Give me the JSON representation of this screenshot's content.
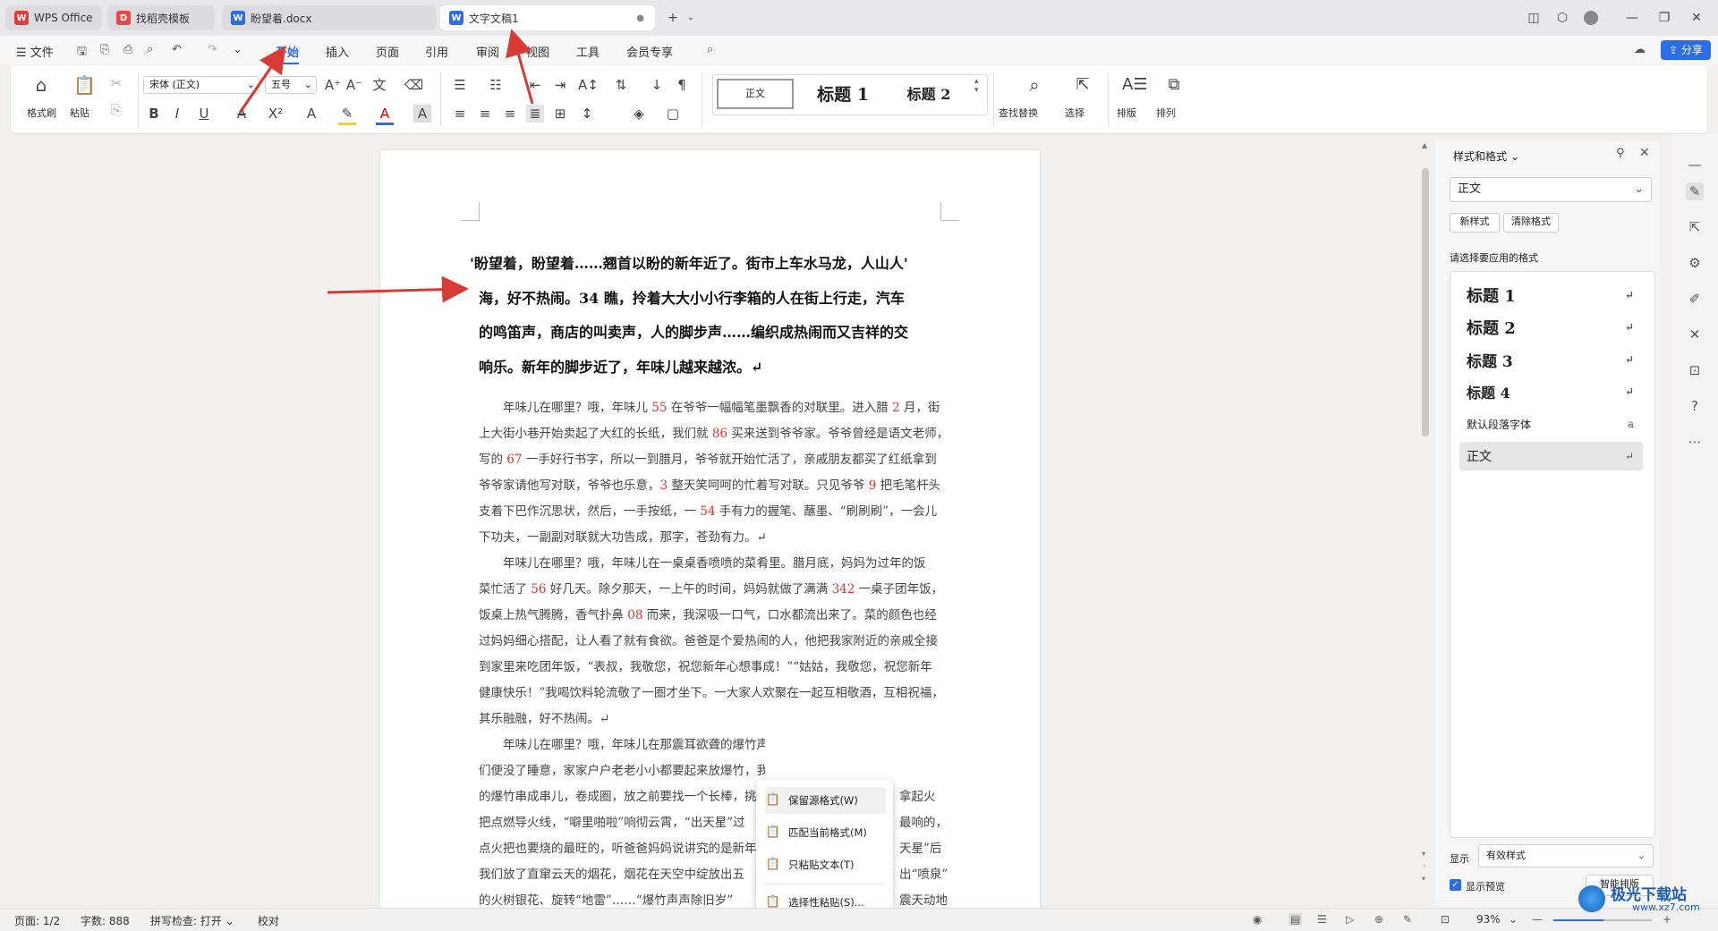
{
  "tabs": [
    {
      "label": "WPS Office",
      "icon": "wps-logo-icon",
      "state": "inactive"
    },
    {
      "label": "找稻壳模板",
      "icon": "docer-icon",
      "state": "inactive"
    },
    {
      "label": "盼望着.docx",
      "icon": "word-doc-icon",
      "state": "inactive"
    },
    {
      "label": "文字文稿1",
      "icon": "word-doc-icon",
      "state": "active"
    }
  ],
  "menu": {
    "file": "文件",
    "items": [
      "开始",
      "插入",
      "页面",
      "引用",
      "审阅",
      "视图",
      "工具",
      "会员专享"
    ],
    "active": "开始",
    "share": "分享"
  },
  "ribbon": {
    "format_painter": "格式刷",
    "paste": "粘贴",
    "font_name": "宋体 (正文)",
    "font_size": "五号",
    "styles": [
      "正文",
      "标题 1",
      "标题 2"
    ],
    "find_replace": "查找替换",
    "select": "选择",
    "layout": "排版",
    "arrange": "排列"
  },
  "document": {
    "bold_lines": [
      "'盼望着，盼望着……翘首以盼的新年近了。街市上车水马龙，人山人'",
      "海，好不热闹。34 瞧，拎着大大小小行李箱的人在街上行走，汽车",
      "的鸣笛声，商店的叫卖声，人的脚步声……编织成热闹而又吉祥的交",
      "响乐。新年的脚步近了，年味儿越来越浓。↵"
    ],
    "para1": [
      [
        "　　年味儿在哪里？哦，年味儿 ",
        "55",
        " 在爷爷一幅幅笔墨飘香的对联里。进入腊 ",
        "2",
        " 月，街"
      ],
      [
        "上大街小巷开始卖起了大红的长纸，我们就 ",
        "86",
        " 买来送到爷爷家。爷爷曾经是语文老师，"
      ],
      [
        "写的 ",
        "67",
        " 一手好行书字，所以一到腊月，爷爷就开始忙活了，亲戚朋友都买了红纸拿到"
      ],
      [
        "爷爷家请他写对联，爷爷也乐意，",
        "3",
        " 整天笑呵呵的忙着写对联。只见爷爷 ",
        "9",
        " 把毛笔杆头"
      ],
      [
        "支着下巴作沉思状，然后，一手按纸，一 ",
        "54",
        " 手有力的握笔、蘸墨、“刷刷刷”，一会儿"
      ],
      [
        "下功夫，一副副对联就大功告成，那字，苍劲有力。↵"
      ]
    ],
    "para2": [
      [
        "　　年味儿在哪里？哦，年味儿在一桌桌香喷喷的菜肴里。腊月底，妈妈为过年的饭"
      ],
      [
        "菜忙活了 ",
        "56",
        " 好几天。除夕那天，一上午的时间，妈妈就做了满满 ",
        "342",
        " 一桌子团年饭，"
      ],
      [
        "饭桌上热气腾腾，香气扑鼻 ",
        "08",
        " 而来，我深吸一口气，口水都流出来了。菜的颜色也经"
      ],
      [
        "过妈妈细心搭配，让人看了就有食欲。爸爸是个爱热闹的人，他把我家附近的亲戚全接"
      ],
      [
        "到家里来吃团年饭，“表叔，我敬您，祝您新年心想事成！”“姑姑，我敬您，祝您新年"
      ],
      [
        "健康快乐！”我喝饮料轮流敬了一圈才坐下。一大家人欢聚在一起互相敬酒，互相祝福，"
      ],
      [
        "其乐融融，好不热闹。↵"
      ]
    ],
    "para3": [
      [
        "　　年味儿在哪里？哦，年味儿在那震耳欲聋的爆竹声中。新年第一天零点开始，人"
      ],
      [
        "们便没了睡意，家家户户老老小小都要起来放爆竹，我们那里叫“出天星”。大小单个"
      ],
      [
        "的爆竹串成串儿，卷成圈，放之前要找一个长棒，挑"
      ],
      [
        "把点燃导火线，“噼里啪啦”响彻云霄，“出天星”过"
      ],
      [
        "点火把也要烧的最旺的，听爸爸妈妈说讲究的是新年"
      ],
      [
        "我们放了直窜云天的烟花，烟花在天空中绽放出五"
      ],
      [
        "的火树银花、旋转“地雷”……“爆竹声声除旧岁”"
      ]
    ],
    "para3_right": [
      "拿起火",
      "最响的，",
      "天星”后",
      "出“喷泉”",
      "震天动地"
    ]
  },
  "context_menu": {
    "items": [
      "保留源格式(W)",
      "匹配当前格式(M)",
      "只粘贴文本(T)",
      "选择性粘贴(S)..."
    ]
  },
  "panel": {
    "title": "样式和格式",
    "current_style": "正文",
    "new_style": "新样式",
    "clear_format": "清除格式",
    "prompt": "请选择要应用的格式",
    "styles": [
      "标题 1",
      "标题 2",
      "标题 3",
      "标题 4",
      "默认段落字体",
      "正文"
    ],
    "show_label": "显示",
    "show_value": "有效样式",
    "preview_label": "显示预览",
    "smart_layout": "智能排版"
  },
  "status": {
    "page": "页面: 1/2",
    "words": "字数: 888",
    "spell": "拼写检查: 打开",
    "proof": "校对",
    "zoom": "93%"
  },
  "watermark": "极光下载站",
  "watermark_url": "www.xz7.com",
  "colors": {
    "accent": "#2b6de5",
    "red_number": "#e0322f",
    "arrow": "#d83a35"
  }
}
